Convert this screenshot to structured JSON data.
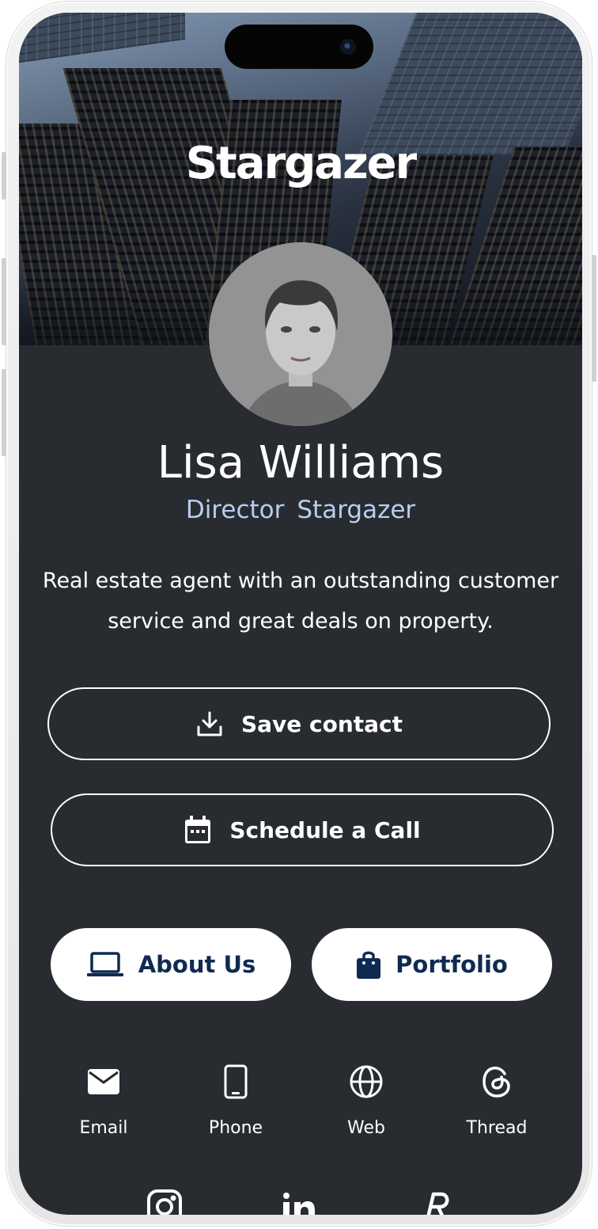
{
  "brand": {
    "name": "Stargazer"
  },
  "profile": {
    "name": "Lisa Williams",
    "role": "Director",
    "company": "Stargazer",
    "bio": "Real estate agent with an outstanding customer service and great deals on property."
  },
  "actions": {
    "save_contact": "Save contact",
    "schedule_call": "Schedule a Call",
    "about_us": "About Us",
    "portfolio": "Portfolio"
  },
  "social": [
    {
      "label": "Email",
      "icon": "mail-icon"
    },
    {
      "label": "Phone",
      "icon": "phone-icon"
    },
    {
      "label": "Web",
      "icon": "globe-icon"
    },
    {
      "label": "Thread",
      "icon": "threads-icon"
    }
  ],
  "social_more_icons": [
    "instagram-icon",
    "linkedin-icon",
    "booking-icon"
  ],
  "colors": {
    "background": "#282b30",
    "accent_text": "#b9cdf0",
    "button_solid_bg": "#ffffff",
    "button_solid_text": "#0f2a52"
  }
}
